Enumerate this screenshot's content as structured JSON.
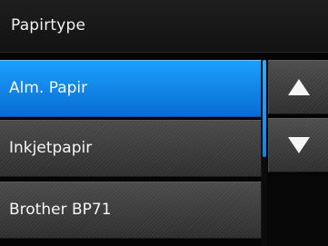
{
  "header": {
    "title": "Papirtype"
  },
  "list": {
    "items": [
      {
        "label": "Alm. Papir",
        "selected": true
      },
      {
        "label": "Inkjetpapir",
        "selected": false
      },
      {
        "label": "Brother BP71",
        "selected": false
      }
    ]
  },
  "nav": {
    "up_icon": "triangle-up-icon",
    "down_icon": "triangle-down-icon"
  },
  "colors": {
    "selected": "#0a7fe0",
    "item": "#3a3a3a",
    "background": "#050505"
  }
}
